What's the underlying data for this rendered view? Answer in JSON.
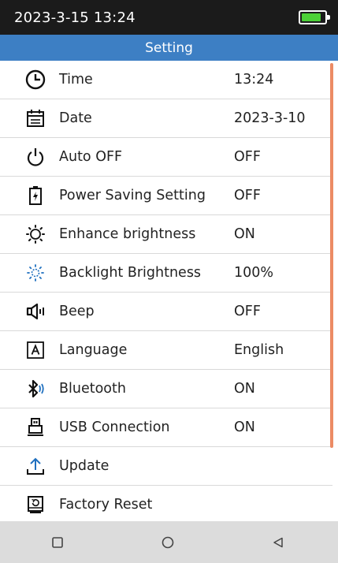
{
  "status": {
    "datetime": "2023-3-15 13:24",
    "battery_level": 0.85,
    "battery_color": "#4cd137"
  },
  "header": {
    "title": "Setting",
    "color": "#3d7fc4"
  },
  "settings": [
    {
      "icon": "clock-icon",
      "label": "Time",
      "value": "13:24"
    },
    {
      "icon": "calendar-icon",
      "label": "Date",
      "value": "2023-3-10"
    },
    {
      "icon": "power-icon",
      "label": "Auto OFF",
      "value": "OFF"
    },
    {
      "icon": "battery-saver-icon",
      "label": "Power Saving Setting",
      "value": "OFF"
    },
    {
      "icon": "brightness-enhance-icon",
      "label": "Enhance brightness",
      "value": "ON"
    },
    {
      "icon": "backlight-icon",
      "label": "Backlight Brightness",
      "value": "100%"
    },
    {
      "icon": "speaker-icon",
      "label": "Beep",
      "value": "OFF"
    },
    {
      "icon": "language-icon",
      "label": "Language",
      "value": "English"
    },
    {
      "icon": "bluetooth-icon",
      "label": "Bluetooth",
      "value": "ON"
    },
    {
      "icon": "usb-icon",
      "label": "USB Connection",
      "value": "ON"
    },
    {
      "icon": "upload-icon",
      "label": "Update",
      "value": ""
    },
    {
      "icon": "factory-reset-icon",
      "label": "Factory Reset",
      "value": ""
    }
  ],
  "navbar": {
    "buttons": [
      "square-icon",
      "circle-icon",
      "back-triangle-icon"
    ]
  },
  "colors": {
    "scrollbar": "#ec8b64",
    "navbar": "#dcdcdc"
  }
}
